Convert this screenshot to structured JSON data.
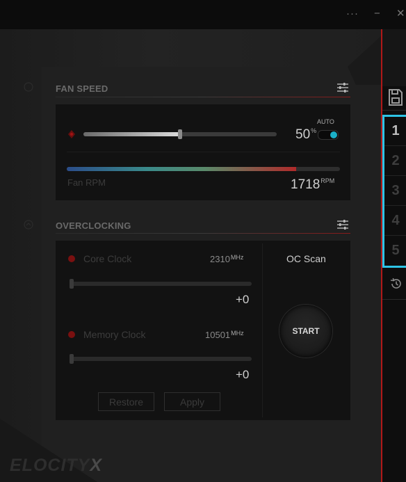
{
  "window": {
    "more_glyph": "···",
    "minimize_glyph": "−",
    "close_glyph": "✕"
  },
  "fan_speed": {
    "title": "FAN SPEED",
    "auto_label": "AUTO",
    "percent": 50,
    "percent_value": "50",
    "percent_unit": "%",
    "slider_fraction": 0.5,
    "rpm_label": "Fan RPM",
    "rpm_value": "1718",
    "rpm_unit": "RPM",
    "rpm_fraction": 0.84
  },
  "overclocking": {
    "title": "OVERCLOCKING",
    "core": {
      "label": "Core Clock",
      "value": "2310",
      "unit": "MHz",
      "delta": "+0"
    },
    "memory": {
      "label": "Memory Clock",
      "value": "10501",
      "unit": "MHz",
      "delta": "+0"
    },
    "oc_scan_label": "OC Scan",
    "start_label": "START",
    "restore_label": "Restore",
    "apply_label": "Apply"
  },
  "profiles": {
    "items": [
      "1",
      "2",
      "3",
      "4",
      "5"
    ],
    "active": "1"
  },
  "brand": {
    "text": "ELOCITY",
    "x": "X"
  },
  "colors": {
    "accent_cyan": "#2ec4e6",
    "accent_red": "#b01818",
    "toggle_on": "#1bb0c8"
  }
}
